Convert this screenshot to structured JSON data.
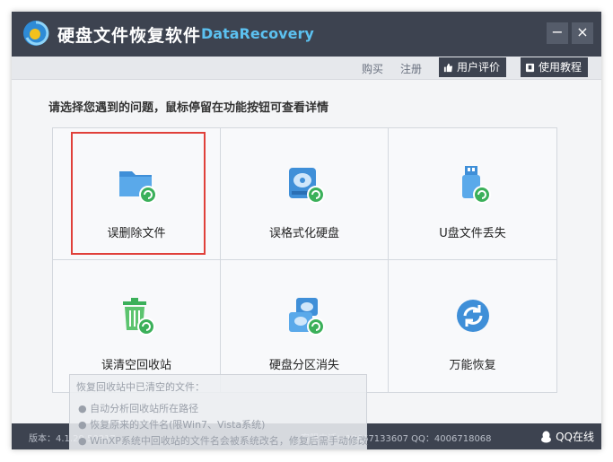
{
  "window": {
    "title_cn": "硬盘文件恢复软件",
    "title_en": "DataRecovery",
    "minimize_label": "−",
    "close_label": "×"
  },
  "toolbar": {
    "buy_label": "购买",
    "register_label": "注册",
    "review_label": "用户评价",
    "tutorial_label": "使用教程"
  },
  "main": {
    "prompt": "请选择您遇到的问题，鼠标停留在功能按钮可查看详情",
    "features": [
      {
        "label": "误删除文件",
        "icon": "folder-recover-icon",
        "selected": true
      },
      {
        "label": "误格式化硬盘",
        "icon": "disk-recover-icon",
        "selected": false
      },
      {
        "label": "U盘文件丢失",
        "icon": "usb-recover-icon",
        "selected": false
      },
      {
        "label": "误清空回收站",
        "icon": "trash-recover-icon",
        "selected": false
      },
      {
        "label": "硬盘分区消失",
        "icon": "partition-recover-icon",
        "selected": false
      },
      {
        "label": "万能恢复",
        "icon": "universal-recover-icon",
        "selected": false
      }
    ]
  },
  "tooltip": {
    "heading": "恢复回收站中已清空的文件：",
    "items": [
      "● 自动分析回收站所在路径",
      "● 恢复原来的文件名(限Win7、Vista系统)",
      "● WinXP系统中回收站的文件名会被系统改名，修复后需手动修改"
    ]
  },
  "status": {
    "version": "版本：4.1.29.50317",
    "contact": "客服电话：18667133607 QQ：4006718068",
    "qq_label": "QQ在线"
  },
  "colors": {
    "titlebar": "#3d4350",
    "accent_blue": "#5cc1f0",
    "icon_blue": "#3f8fd8",
    "icon_green": "#3bb05a",
    "selection_red": "#e0403a"
  }
}
